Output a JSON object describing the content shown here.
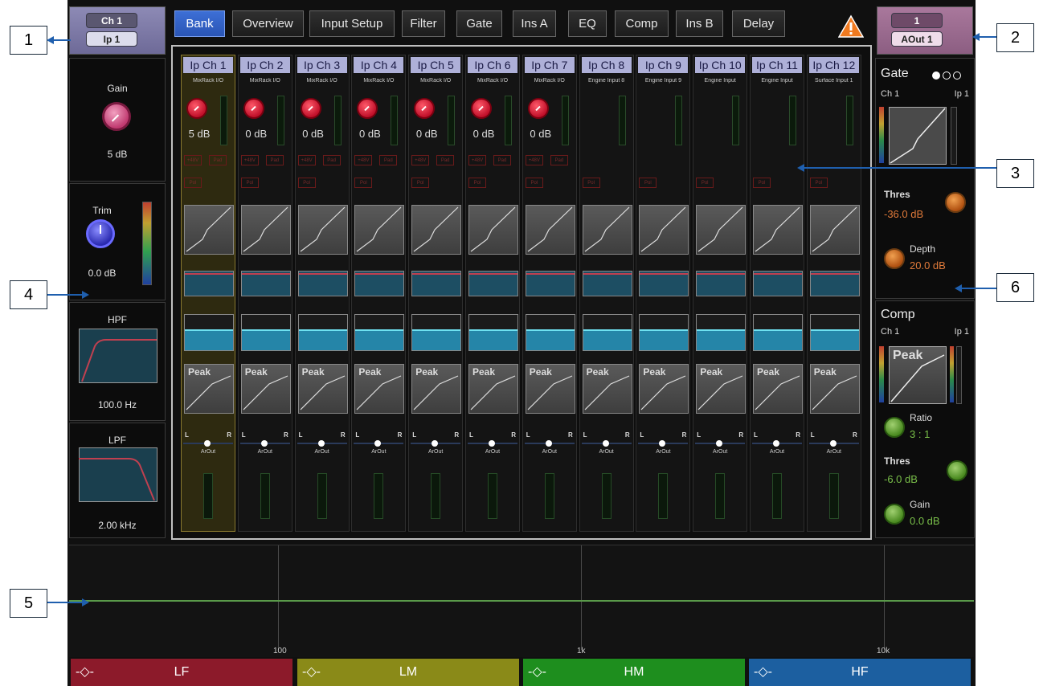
{
  "input_channel": {
    "number": "Ch 1",
    "name": "Ip 1"
  },
  "output": {
    "number": "1",
    "name": "AOut 1"
  },
  "tabs": [
    "Bank",
    "Overview",
    "Input Setup",
    "Filter",
    "Gate",
    "Ins A",
    "EQ",
    "Comp",
    "Ins B",
    "Delay"
  ],
  "active_tab": "Bank",
  "warning_icon": "warning-triangle-icon",
  "left_panel": {
    "gain": {
      "label": "Gain",
      "value": "5 dB"
    },
    "trim": {
      "label": "Trim",
      "value": "0.0 dB"
    },
    "hpf": {
      "label": "HPF",
      "value": "100.0 Hz"
    },
    "lpf": {
      "label": "LPF",
      "value": "2.00 kHz"
    }
  },
  "strips": [
    {
      "name": "Ip Ch 1",
      "source": "MixRack I/O",
      "gain": "5 dB",
      "selected": true
    },
    {
      "name": "Ip Ch 2",
      "source": "MixRack I/O",
      "gain": "0 dB"
    },
    {
      "name": "Ip Ch 3",
      "source": "MixRack I/O",
      "gain": "0 dB"
    },
    {
      "name": "Ip Ch 4",
      "source": "MixRack I/O",
      "gain": "0 dB"
    },
    {
      "name": "Ip Ch 5",
      "source": "MixRack I/O",
      "gain": "0 dB"
    },
    {
      "name": "Ip Ch 6",
      "source": "MixRack I/O",
      "gain": "0 dB"
    },
    {
      "name": "Ip Ch 7",
      "source": "MixRack I/O",
      "gain": "0 dB"
    },
    {
      "name": "Ip Ch 8",
      "source": "Engine Input 8",
      "gain": ""
    },
    {
      "name": "Ip Ch 9",
      "source": "Engine Input 9",
      "gain": ""
    },
    {
      "name": "Ip Ch 10",
      "source": "Engine Input",
      "gain": ""
    },
    {
      "name": "Ip Ch 11",
      "source": "Engine Input",
      "gain": ""
    },
    {
      "name": "Ip Ch 12",
      "source": "Surface Input 1",
      "gain": ""
    }
  ],
  "strip_labels": {
    "phantom": "+48V",
    "pad": "Pad",
    "polarity": "Pol",
    "peak": "Peak",
    "pan_l": "L",
    "pan_r": "R",
    "output": "ArOut"
  },
  "right_panel": {
    "gate": {
      "title": "Gate",
      "ch": "Ch 1",
      "ip": "Ip 1",
      "thres_label": "Thres",
      "thres": "-36.0 dB",
      "depth_label": "Depth",
      "depth": "20.0 dB"
    },
    "comp": {
      "title": "Comp",
      "ch": "Ch 1",
      "ip": "Ip 1",
      "peak": "Peak",
      "ratio_label": "Ratio",
      "ratio": "3 : 1",
      "thres_label": "Thres",
      "thres": "-6.0 dB",
      "gain_label": "Gain",
      "gain": "0.0 dB"
    }
  },
  "eq_graph": {
    "ticks": [
      "100",
      "1k",
      "10k"
    ]
  },
  "eq_bands": [
    {
      "label": "LF",
      "color": "#8c1a2a"
    },
    {
      "label": "LM",
      "color": "#8a8a18"
    },
    {
      "label": "HM",
      "color": "#1e8e1e"
    },
    {
      "label": "HF",
      "color": "#1c5fa0"
    }
  ],
  "callouts": [
    "1",
    "2",
    "3",
    "4",
    "5",
    "6"
  ],
  "colors": {
    "accent": "#2a55b5",
    "callout_arrow": "#1f5fae"
  }
}
